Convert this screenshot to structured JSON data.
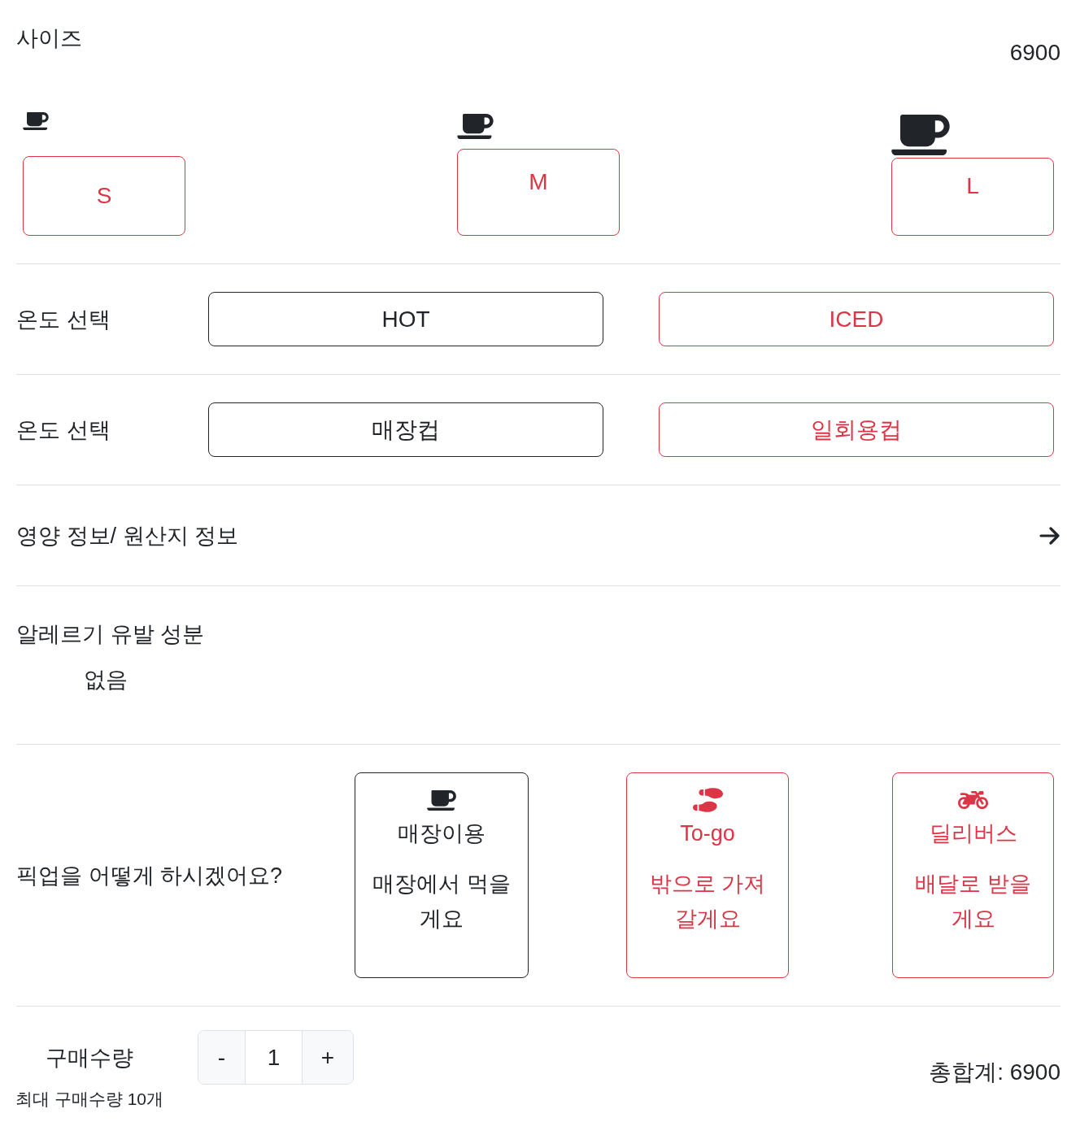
{
  "size_section": {
    "title": "사이즈",
    "price": "6900",
    "options": [
      {
        "label": "S",
        "selected": false
      },
      {
        "label": "M",
        "selected": false
      },
      {
        "label": "L",
        "selected": false
      }
    ]
  },
  "temperature": {
    "label": "온도 선택",
    "options": [
      {
        "label": "HOT",
        "selected": true
      },
      {
        "label": "ICED",
        "selected": false
      }
    ]
  },
  "cup": {
    "label": "온도 선택",
    "options": [
      {
        "label": "매장컵",
        "selected": true
      },
      {
        "label": "일회용컵",
        "selected": false
      }
    ]
  },
  "nutrition_link": {
    "label": "영양 정보/ 원산지 정보"
  },
  "allergens": {
    "title": "알레르기 유발 성분",
    "value": "없음"
  },
  "pickup": {
    "question": "픽업을 어떻게 하시겠어요?",
    "options": [
      {
        "kind": "store",
        "title": "매장이용",
        "description": "매장에서 먹을게요",
        "selected": true
      },
      {
        "kind": "togo",
        "title": "To-go",
        "description": "밖으로 가져갈게요",
        "selected": false
      },
      {
        "kind": "delivery",
        "title": "딜리버스",
        "description": "배달로 받을게요",
        "selected": false
      }
    ]
  },
  "quantity": {
    "label": "구매수량",
    "decrement": "-",
    "value": "1",
    "increment": "+",
    "limit_note": "최대 구매수량 10개"
  },
  "total": "총합계: 6900"
}
